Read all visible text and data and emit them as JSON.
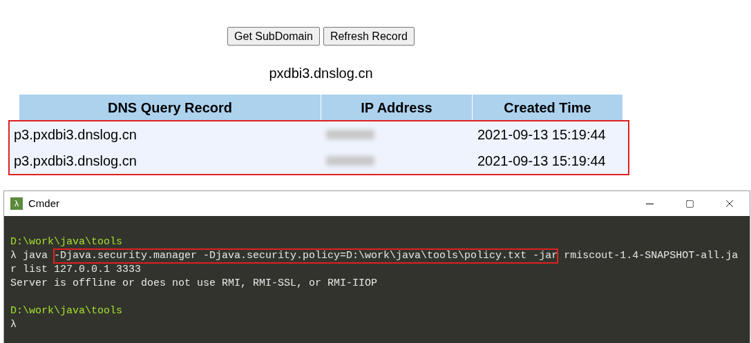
{
  "buttons": [
    "Get SubDomain",
    "Refresh Record"
  ],
  "domain": "pxdbi3.dnslog.cn",
  "table": {
    "columns": [
      "DNS Query Record",
      "IP Address",
      "Created Time"
    ],
    "highlighted": true,
    "rows": [
      {
        "record": "p3.pxdbi3.dnslog.cn",
        "ip_redacted": true,
        "time": "2021-09-13 15:19:44"
      },
      {
        "record": "p3.pxdbi3.dnslog.cn",
        "ip_redacted": true,
        "time": "2021-09-13 15:19:44"
      }
    ]
  },
  "terminal": {
    "title": "Cmder",
    "icon": "λ",
    "lines": [
      {
        "kind": "blank"
      },
      {
        "kind": "path",
        "text": "D:\\work\\java\\tools"
      },
      {
        "kind": "command",
        "parts": [
          {
            "text": "λ java ",
            "highlighted": false
          },
          {
            "text": "-Djava.security.manager -Djava.security.policy=D:\\work\\java\\tools\\policy.txt -jar",
            "highlighted": true
          },
          {
            "text": " rmiscout-1.4-SNAPSHOT-all.ja",
            "highlighted": false
          }
        ]
      },
      {
        "kind": "output",
        "text": "r list 127.0.0.1 3333"
      },
      {
        "kind": "output",
        "text": "Server is offline or does not use RMI, RMI-SSL, or RMI-IIOP"
      },
      {
        "kind": "blank"
      },
      {
        "kind": "path",
        "text": "D:\\work\\java\\tools"
      },
      {
        "kind": "output",
        "text": "λ"
      }
    ]
  }
}
